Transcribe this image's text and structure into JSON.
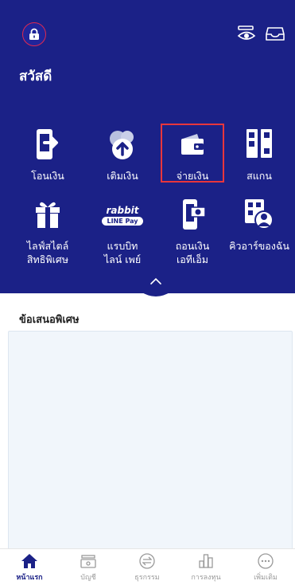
{
  "header": {
    "greeting": "สวัสดี"
  },
  "menu": [
    {
      "label": "โอนเงิน",
      "icon": "phone-transfer-icon"
    },
    {
      "label": "เติมเงิน",
      "icon": "topup-icon"
    },
    {
      "label": "จ่ายเงิน",
      "icon": "wallet-icon"
    },
    {
      "label": "สแกน",
      "icon": "scan-icon"
    },
    {
      "label": "ไลฟ์สไตล์\nสิทธิพิเศษ",
      "icon": "gift-icon"
    },
    {
      "label": "แรบบิท\nไลน์ เพย์",
      "icon": "rabbit-linepay-icon"
    },
    {
      "label": "ถอนเงิน\nเอทีเอ็ม",
      "icon": "atm-withdraw-icon"
    },
    {
      "label": "คิวอาร์ของฉัน",
      "icon": "my-qr-icon"
    }
  ],
  "rabbit_logo": {
    "top": "rabbit",
    "bottom": "LINE Pay"
  },
  "promo": {
    "title": "ข้อเสนอพิเศษ"
  },
  "bottom_nav": [
    {
      "label": "หน้าแรก",
      "icon": "home-icon",
      "active": true
    },
    {
      "label": "บัญชี",
      "icon": "account-icon",
      "active": false
    },
    {
      "label": "ธุรกรรม",
      "icon": "transaction-icon",
      "active": false
    },
    {
      "label": "การลงทุน",
      "icon": "investment-icon",
      "active": false
    },
    {
      "label": "เพิ่มเติม",
      "icon": "more-icon",
      "active": false
    }
  ],
  "colors": {
    "brand_navy": "#1b2187",
    "highlight_red": "#e8363c",
    "lock_ring": "#e0294f",
    "card_bg": "#f1f6fb"
  }
}
